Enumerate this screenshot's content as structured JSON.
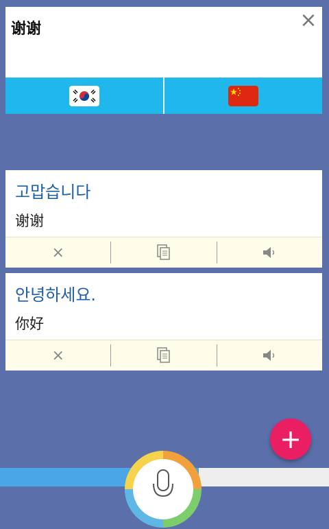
{
  "input": {
    "text": "谢谢",
    "clear_icon": "close-icon"
  },
  "languages": {
    "source": "Korean",
    "target": "Chinese",
    "colors": {
      "bar": "#20b7ec"
    }
  },
  "results": [
    {
      "source_text": "고맙습니다",
      "translation": "谢谢"
    },
    {
      "source_text": "안녕하세요.",
      "translation": "你好"
    }
  ],
  "actions": {
    "delete_glyph": "×",
    "copy_icon": "copy-icon",
    "speaker_icon": "speaker-icon"
  },
  "fab": {
    "glyph": "+",
    "color": "#e91e63"
  },
  "colors": {
    "background": "#5b6faa",
    "source_text": "#1f5fa5",
    "action_bar": "#fdfdea"
  }
}
